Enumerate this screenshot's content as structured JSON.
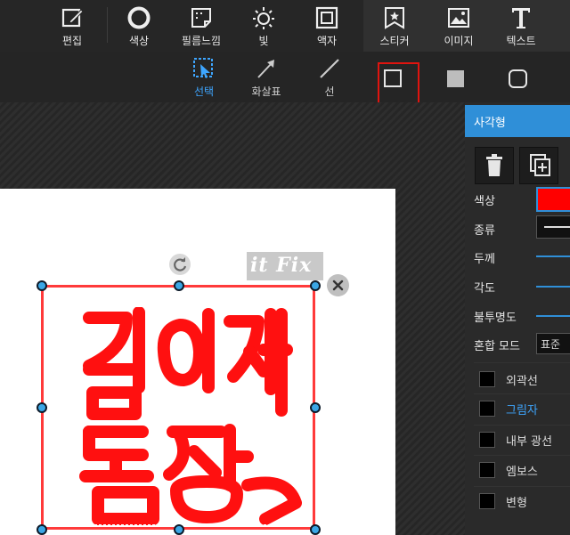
{
  "toolbar": {
    "tools": [
      {
        "label": "편집",
        "icon": "edit-icon"
      },
      {
        "label": "색상",
        "icon": "color-circle-icon"
      },
      {
        "label": "필름느낌",
        "icon": "film-icon"
      },
      {
        "label": "빛",
        "icon": "light-sun-icon"
      },
      {
        "label": "액자",
        "icon": "frame-icon"
      },
      {
        "label": "스티커",
        "icon": "sticker-icon"
      },
      {
        "label": "이미지",
        "icon": "image-icon"
      },
      {
        "label": "텍스트",
        "icon": "text-icon"
      }
    ]
  },
  "subtoolbar": {
    "tools": [
      {
        "label": "선택",
        "icon": "select-cursor-icon",
        "active": true
      },
      {
        "label": "화살표",
        "icon": "arrow-icon"
      },
      {
        "label": "선",
        "icon": "line-icon"
      }
    ],
    "shapes": [
      {
        "icon": "rectangle-outline-icon",
        "highlighted": true
      },
      {
        "icon": "rectangle-filled-icon"
      },
      {
        "icon": "rounded-rectangle-icon"
      }
    ]
  },
  "panel": {
    "title": "사각형",
    "buttons": [
      {
        "icon": "trash-icon"
      },
      {
        "icon": "duplicate-icon"
      }
    ],
    "props": {
      "color_label": "색상",
      "color_value": "#ff0000",
      "type_label": "종류",
      "thickness_label": "두께",
      "angle_label": "각도",
      "opacity_label": "불투명도",
      "blend_label": "혼합 모드",
      "blend_value": "표준"
    },
    "checks": [
      {
        "label": "외곽선",
        "checked": false,
        "highlighted": false
      },
      {
        "label": "그림자",
        "checked": false,
        "highlighted": true
      },
      {
        "label": "내부 광선",
        "checked": false,
        "highlighted": false
      },
      {
        "label": "엠보스",
        "checked": false,
        "highlighted": false
      },
      {
        "label": "변형",
        "checked": false,
        "highlighted": false
      }
    ]
  },
  "canvas": {
    "watermark_text": "it Fix",
    "stamp_text": "김이재 도장",
    "stamp_color": "#ff0000",
    "accent": "#2f8fd8"
  }
}
